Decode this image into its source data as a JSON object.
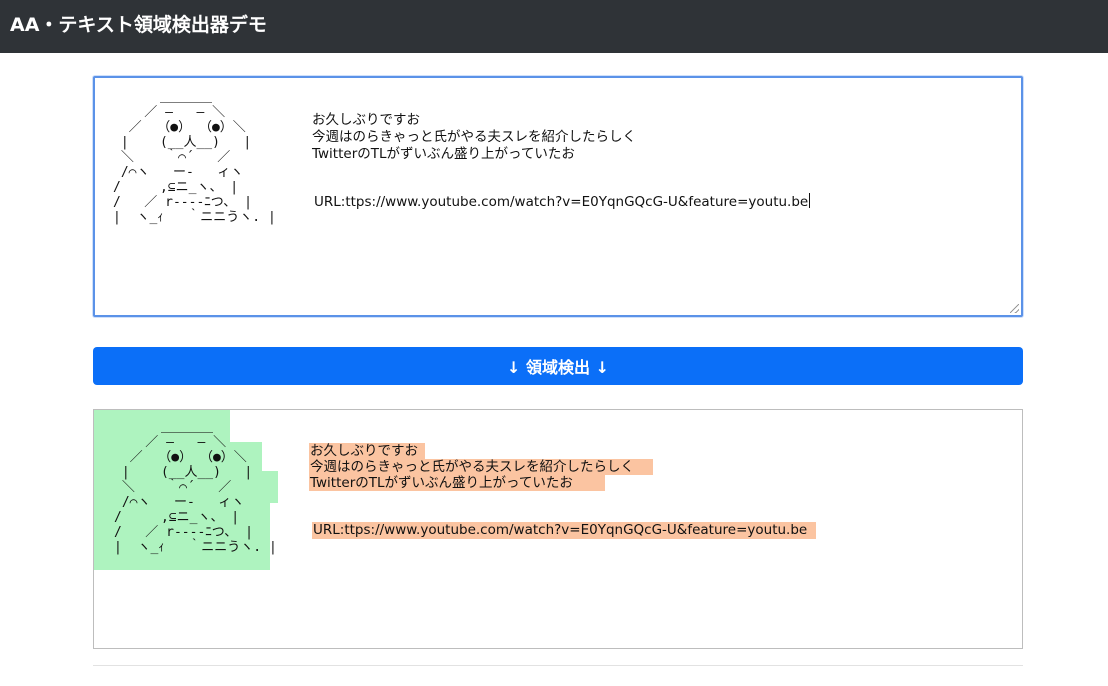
{
  "app": {
    "title": "AA・テキスト領域検出器デモ"
  },
  "editor": {
    "aa_lines": [
      "      ＿＿＿＿",
      "    ／ ―   ― ＼",
      "  ／  （●） （●）＼",
      " |    (__人__)   |",
      " ＼    ｀⌒´   ／",
      " /⌒ヽ   ー‐   ィヽ",
      "/     ,⊆ニ_ヽ、 |",
      "/   ／ r‐‐‐‐ﾆつ、 |",
      "|  ヽ_ｨ   ｀ニニうヽ. |"
    ],
    "text_lines": [
      "お久しぶりですお",
      "今週はのらきゃっと氏がやる夫スレを紹介したらしく",
      "TwitterのTLがずいぶん盛り上がっていたお"
    ],
    "url_line": "URL:ttps://www.youtube.com/watch?v=E0YqnGQcG-U&feature=youtu.be"
  },
  "detect_button": {
    "label": "↓ 領域検出 ↓"
  },
  "result": {
    "aa_region_color": "#aef3bf",
    "text_region_color": "#fbc4a1"
  },
  "colors": {
    "navbar": "#2f3337",
    "accent": "#0b6ff8"
  }
}
